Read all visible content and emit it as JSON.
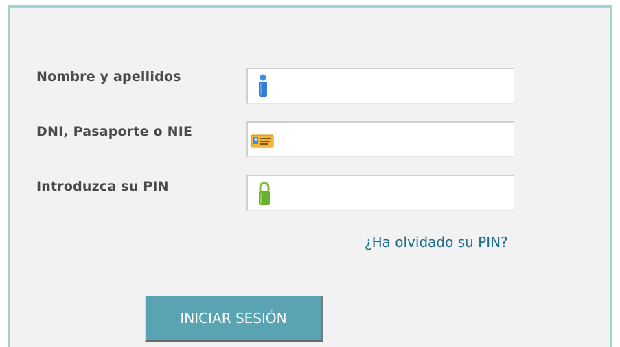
{
  "form": {
    "fields": [
      {
        "label": "Nombre y apellidos",
        "icon": "user-icon",
        "value": "",
        "placeholder": ""
      },
      {
        "label": "DNI, Pasaporte o NIE",
        "icon": "id-card-icon",
        "value": "",
        "placeholder": ""
      },
      {
        "label": "Introduzca su PIN",
        "icon": "lock-icon",
        "value": "",
        "placeholder": ""
      }
    ],
    "forgot_pin_link": "¿Ha olvidado su PIN?",
    "submit_label": "INICIAR SESIÓN"
  },
  "colors": {
    "panel_background": "#f2f2f2",
    "panel_border": "#9fd4cf",
    "label_text": "#4a4a4a",
    "link_text": "#1a6b8a",
    "button_background": "#5aa3b3",
    "button_text": "#ffffff",
    "user_icon": "#2f7fd6",
    "id_card_icon": "#f0a020",
    "lock_icon": "#6ab02e"
  }
}
